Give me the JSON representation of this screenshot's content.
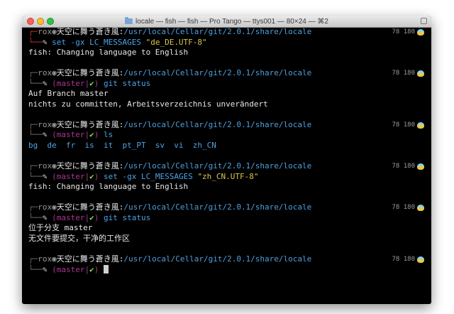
{
  "window": {
    "title": "locale — fish — fish — Pro Tango — ttys001 — 80×24 — ⌘2"
  },
  "prompt": {
    "corner_top": "┌─",
    "corner_bottom": "└──",
    "user": "rox",
    "bullet": "◉",
    "host": "天空に舞う蒼き風:",
    "path": "/usr/local/Cellar/git/2.0.1/share/locale",
    "pencil": "✎",
    "branch_text": "(master|",
    "check": "✔",
    "branch_close": ")",
    "right_text": "78 180",
    "right_icon": "fish-status-icon"
  },
  "blocks": [
    {
      "repo": false,
      "command": "set -gx LC_MESSAGES ",
      "string": "\"de_DE.UTF-8\"",
      "output": [
        "fish: Changing language to English"
      ]
    },
    {
      "repo": true,
      "command": "git status",
      "string": "",
      "output": [
        "Auf Branch master",
        "nichts zu committen, Arbeitsverzeichnis unverändert"
      ]
    },
    {
      "repo": true,
      "command": "ls",
      "string": "",
      "output": [
        "bg  de  fr  is  it  pt_PT  sv  vi  zh_CN"
      ],
      "output_color": "#4aa3e8"
    },
    {
      "repo": true,
      "command": "set -gx LC_MESSAGES ",
      "string": "\"zh_CN.UTF-8\"",
      "output": [
        "fish: Changing language to English"
      ]
    },
    {
      "repo": true,
      "command": "git status",
      "string": "",
      "output": [
        "位于分支 master",
        "无文件要提交，干净的工作区"
      ]
    },
    {
      "repo": true,
      "command": "",
      "string": "",
      "output": [],
      "cursor": true
    }
  ],
  "colors": {
    "background": "#000000",
    "path": "#4f9fdc",
    "command": "#4aa3e8",
    "string": "#d6c64a",
    "branch": "#a8398f",
    "check": "#7ee34a",
    "corner": "#c8323a"
  }
}
